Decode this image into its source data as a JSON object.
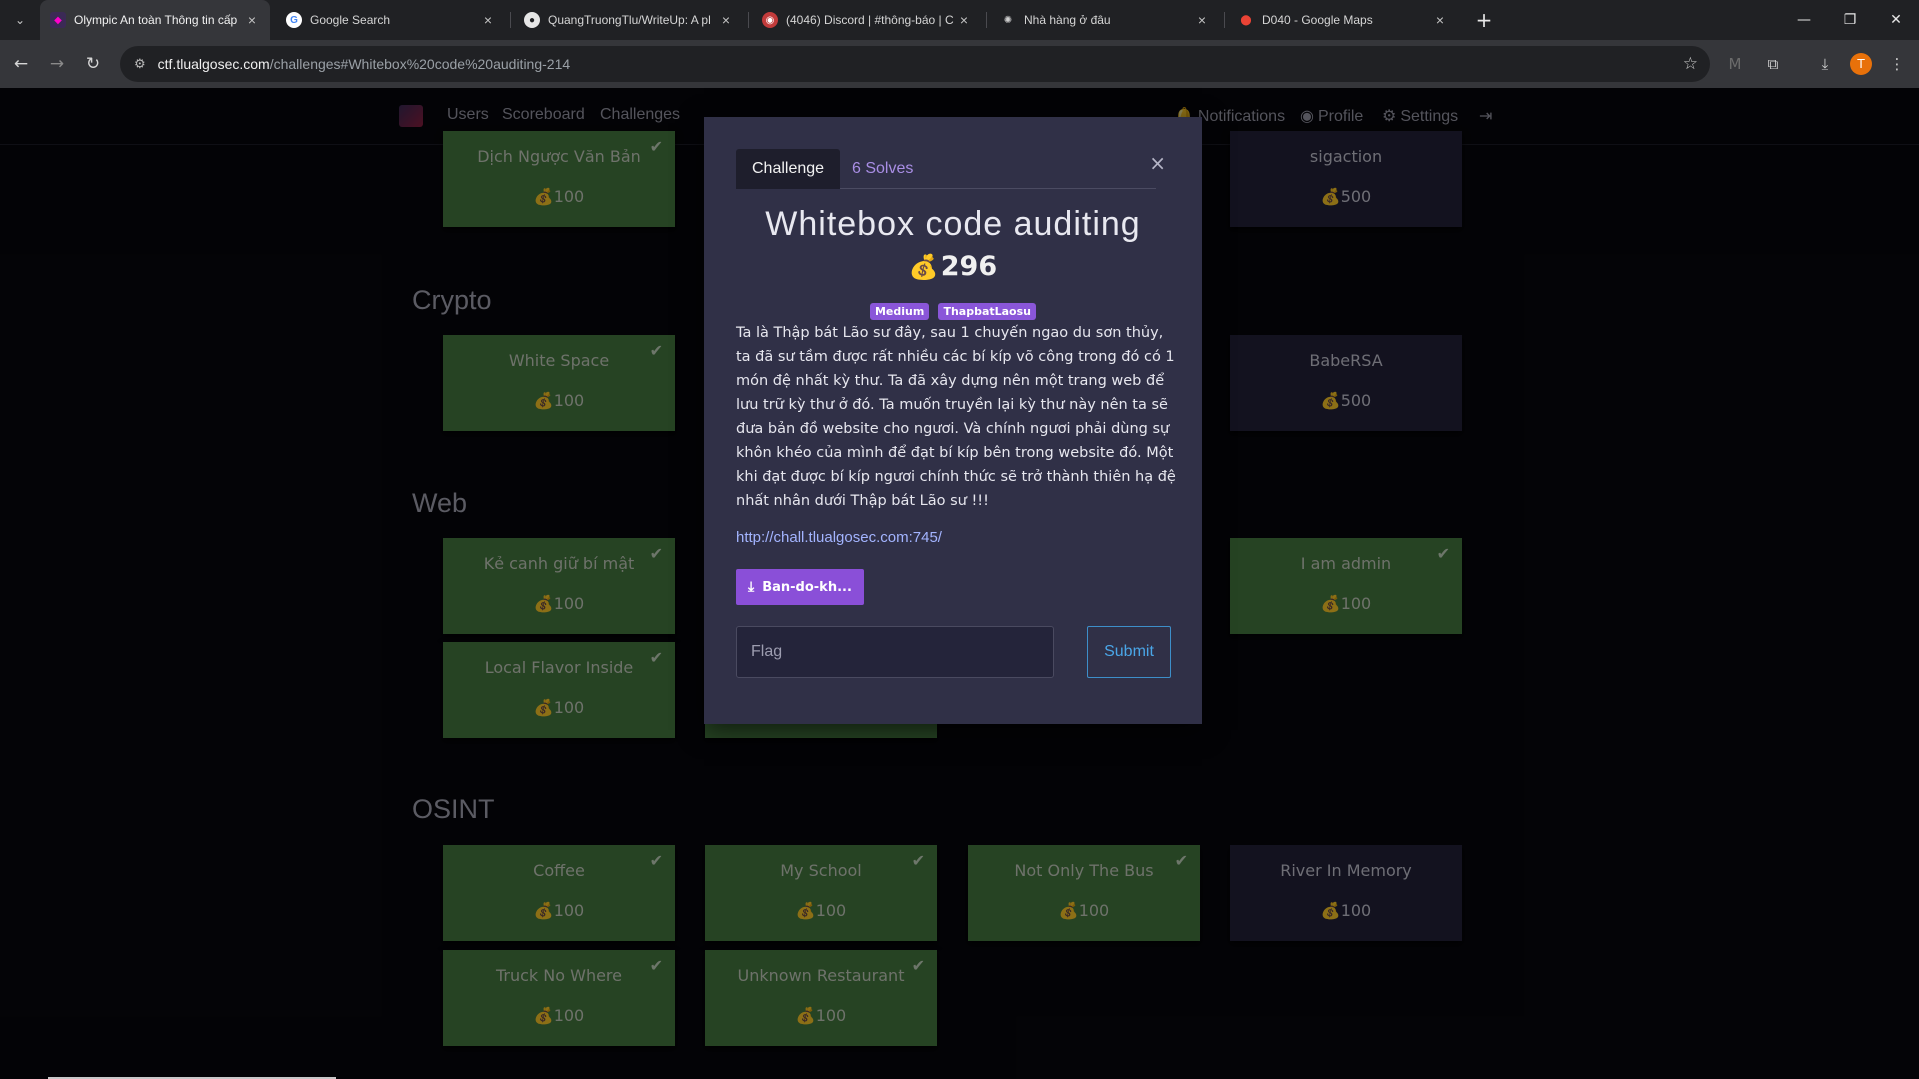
{
  "browser": {
    "tabs": [
      {
        "title": "Olympic An toàn Thông tin cấp",
        "active": true
      },
      {
        "title": "Google Search",
        "active": false
      },
      {
        "title": "QuangTruongTlu/WriteUp: A pl",
        "active": false
      },
      {
        "title": "(4046) Discord | #thông-báo | C",
        "active": false
      },
      {
        "title": "Nhà hàng ở đâu",
        "active": false
      },
      {
        "title": "D040 - Google Maps",
        "active": false
      }
    ],
    "url_host": "ctf.tlualgosec.com",
    "url_path": "/challenges#Whitebox%20code%20auditing-214",
    "profile_initial": "T"
  },
  "nav": {
    "users": "Users",
    "scoreboard": "Scoreboard",
    "challenges": "Challenges",
    "notifications": "Notifications",
    "profile": "Profile",
    "settings": "Settings"
  },
  "categories": {
    "crypto": "Crypto",
    "web": "Web",
    "osint": "OSINT"
  },
  "cards": {
    "c1": {
      "name": "Dịch Ngược Văn Bản",
      "value": "100"
    },
    "c2": {
      "name": "sigaction",
      "value": "500"
    },
    "c3": {
      "name": "White Space",
      "value": "100"
    },
    "c4": {
      "name": "BabeRSA",
      "value": "500"
    },
    "c5": {
      "name": "Kẻ canh giữ bí mật",
      "value": "100"
    },
    "c6": {
      "name": "I am admin",
      "value": "100"
    },
    "c7": {
      "name": "Local Flavor Inside",
      "value": "100"
    },
    "c8": {
      "name": "Coffee",
      "value": "100"
    },
    "c9": {
      "name": "My School",
      "value": "100"
    },
    "c10": {
      "name": "Not Only The Bus",
      "value": "100"
    },
    "c11": {
      "name": "River In Memory",
      "value": "100"
    },
    "c12": {
      "name": "Truck No Where",
      "value": "100"
    },
    "c13": {
      "name": "Unknown Restaurant",
      "value": "100"
    }
  },
  "modal": {
    "tab_challenge": "Challenge",
    "tab_solves": "6 Solves",
    "close": "×",
    "title": "Whitebox code auditing",
    "value": "296",
    "tags": [
      "Medium",
      "ThapbatLaosu"
    ],
    "description": "Ta là Thập bát Lão sư đây, sau 1 chuyến ngao du sơn thủy, ta đã sư tầm được rất nhiều các bí kíp võ công trong đó có 1 món đệ nhất kỳ thư. Ta đã xây dựng nên một trang web để lưu trữ kỳ thư ở đó. Ta muốn truyền lại kỳ thư này nên ta sẽ đưa bản đồ website cho ngươi. Và chính ngươi phải dùng sự khôn khéo của mình để đạt bí kíp bên trong website đó. Một khi đạt được bí kíp ngươi chính thức sẽ trở thành thiên hạ đệ nhất nhân dưới Thập bát Lão sư !!!",
    "link": "http://chall.tlualgosec.com:745/",
    "file_button": "Ban-do-kh...",
    "flag_placeholder": "Flag",
    "submit": "Submit"
  },
  "colors": {
    "solved_card": "#467a41",
    "unsolved_card": "#23213a",
    "modal_bg": "#303047",
    "accent": "#8a4fd8"
  }
}
